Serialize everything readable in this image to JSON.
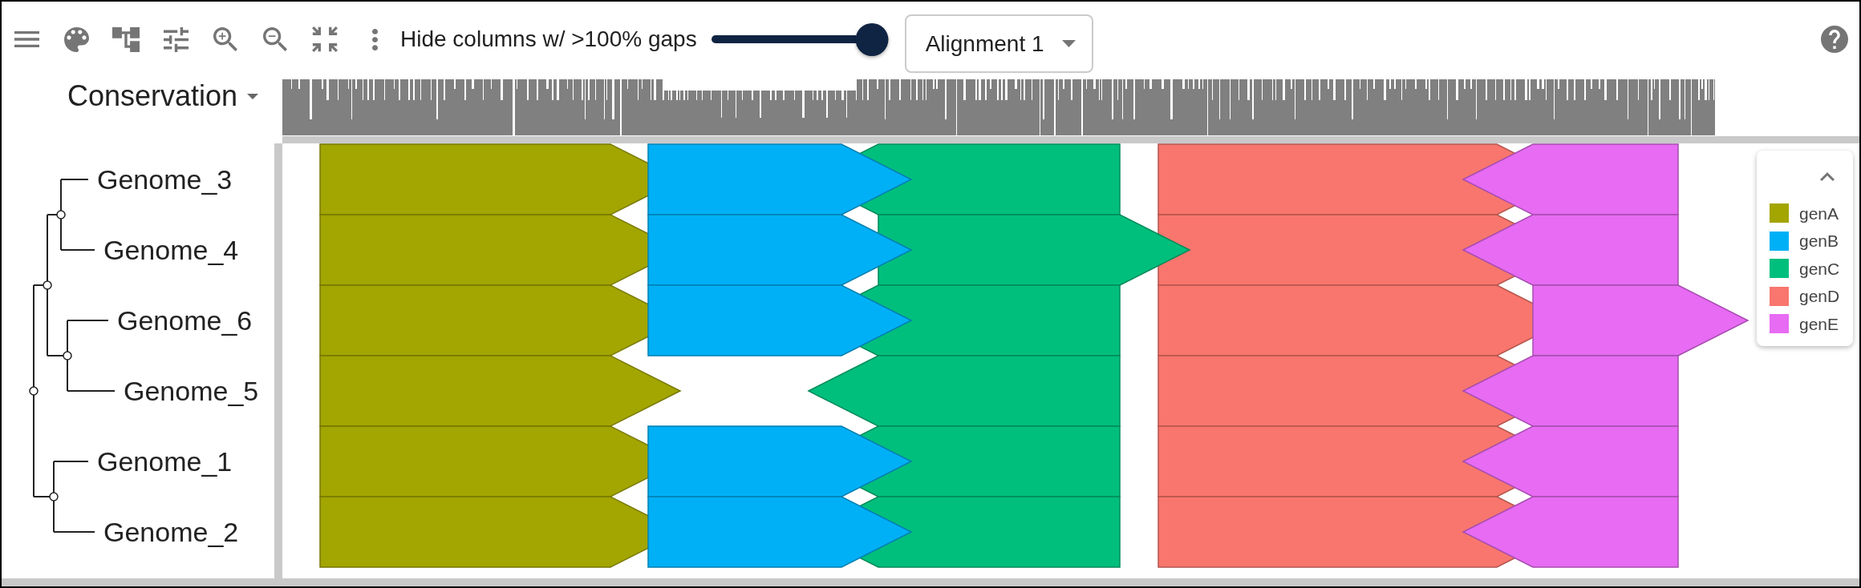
{
  "toolbar": {
    "gap_slider": {
      "label": "Hide columns w/ >100% gaps",
      "level": 1
    },
    "alignment_select": {
      "value": "Alignment 1"
    }
  },
  "track_select": {
    "value": "Conservation"
  },
  "tree": {
    "children": [
      {
        "children": [
          {
            "children": [
              {
                "label": "Genome_3"
              },
              {
                "label": "Genome_4"
              }
            ]
          },
          {
            "children": [
              {
                "label": "Genome_6"
              },
              {
                "label": "Genome_5"
              }
            ]
          }
        ]
      },
      {
        "children": [
          {
            "label": "Genome_1"
          },
          {
            "label": "Genome_2"
          }
        ]
      }
    ]
  },
  "tracks": [
    {
      "genes": [
        {
          "kind": "forward"
        },
        {
          "kind": "forward"
        },
        {
          "kind": "reverse"
        },
        {
          "kind": "forward"
        },
        {
          "kind": "reverse"
        }
      ]
    },
    {
      "genes": [
        {
          "kind": "forward"
        },
        {
          "kind": "forward"
        },
        {
          "kind": "forward"
        },
        {
          "kind": "forward"
        },
        {
          "kind": "reverse"
        }
      ]
    },
    {
      "genes": [
        {
          "kind": "forward"
        },
        {
          "kind": "forward"
        },
        {
          "kind": "reverse"
        },
        {
          "kind": "forward"
        },
        {
          "kind": "forward"
        }
      ]
    },
    {
      "genes": [
        {
          "kind": "forward"
        },
        {
          "kind": "absent"
        },
        {
          "kind": "reverse"
        },
        {
          "kind": "forward"
        },
        {
          "kind": "reverse"
        }
      ]
    },
    {
      "genes": [
        {
          "kind": "forward"
        },
        {
          "kind": "forward"
        },
        {
          "kind": "reverse"
        },
        {
          "kind": "forward"
        },
        {
          "kind": "reverse"
        }
      ]
    },
    {
      "genes": [
        {
          "kind": "forward"
        },
        {
          "kind": "forward"
        },
        {
          "kind": "reverse"
        },
        {
          "kind": "forward"
        },
        {
          "kind": "reverse"
        }
      ]
    }
  ],
  "legend": {
    "expanded": true,
    "items": [
      {
        "label": "genA",
        "color": "#a3a500"
      },
      {
        "label": "genB",
        "color": "#00b0f6"
      },
      {
        "label": "genC",
        "color": "#00bf7d"
      },
      {
        "label": "genD",
        "color": "#f8766d"
      },
      {
        "label": "genE",
        "color": "#e76bf3"
      }
    ]
  }
}
